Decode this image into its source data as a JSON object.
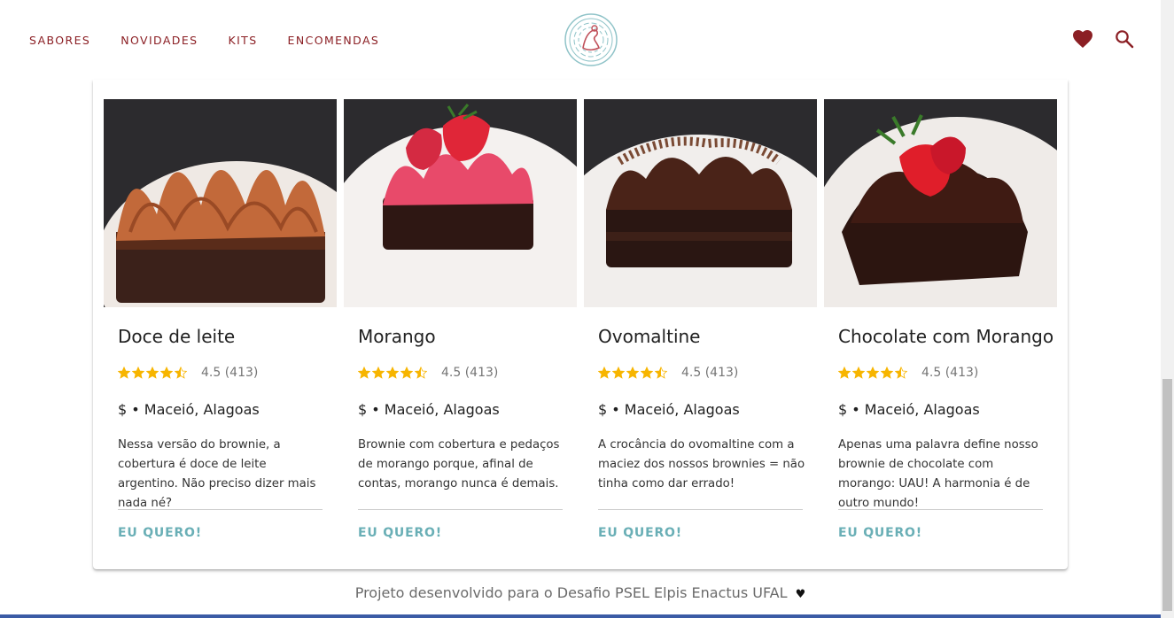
{
  "nav": {
    "items": [
      "SABORES",
      "NOVIDADES",
      "KITS",
      "ENCOMENDAS"
    ]
  },
  "header": {
    "logo_icon": "brand-logo",
    "favorites_icon": "heart-icon",
    "search_icon": "search-icon",
    "accent_color": "#8b1f24"
  },
  "products": [
    {
      "title": "Doce de leite",
      "rating_value": 4.5,
      "rating_text": "4.5 (413)",
      "meta": "$ • Maceió, Alagoas",
      "description": "Nessa versão do brownie, a cobertura é doce de leite argentino. Não preciso dizer mais nada né?",
      "cta": "EU QUERO!"
    },
    {
      "title": "Morango",
      "rating_value": 4.5,
      "rating_text": "4.5 (413)",
      "meta": "$ • Maceió, Alagoas",
      "description": "Brownie com cobertura e pedaços de morango porque, afinal de contas, morango nunca é demais.",
      "cta": "EU QUERO!"
    },
    {
      "title": "Ovomaltine",
      "rating_value": 4.5,
      "rating_text": "4.5 (413)",
      "meta": "$ • Maceió, Alagoas",
      "description": "A crocância do ovomaltine com a maciez dos nossos brownies = não tinha como dar errado!",
      "cta": "EU QUERO!"
    },
    {
      "title": "Chocolate com Morango",
      "rating_value": 4.5,
      "rating_text": "4.5 (413)",
      "meta": "$ • Maceió, Alagoas",
      "description": "Apenas uma palavra define nosso brownie de chocolate com morango: UAU! A harmonia é de outro mundo!",
      "cta": "EU QUERO!"
    }
  ],
  "footer": {
    "text": "Projeto desenvolvido para o Desafio PSEL Elpis Enactus UFAL",
    "icon": "heart-icon"
  },
  "colors": {
    "star": "#f7b500",
    "cta": "#6aafb6",
    "brand": "#8b1f24"
  }
}
